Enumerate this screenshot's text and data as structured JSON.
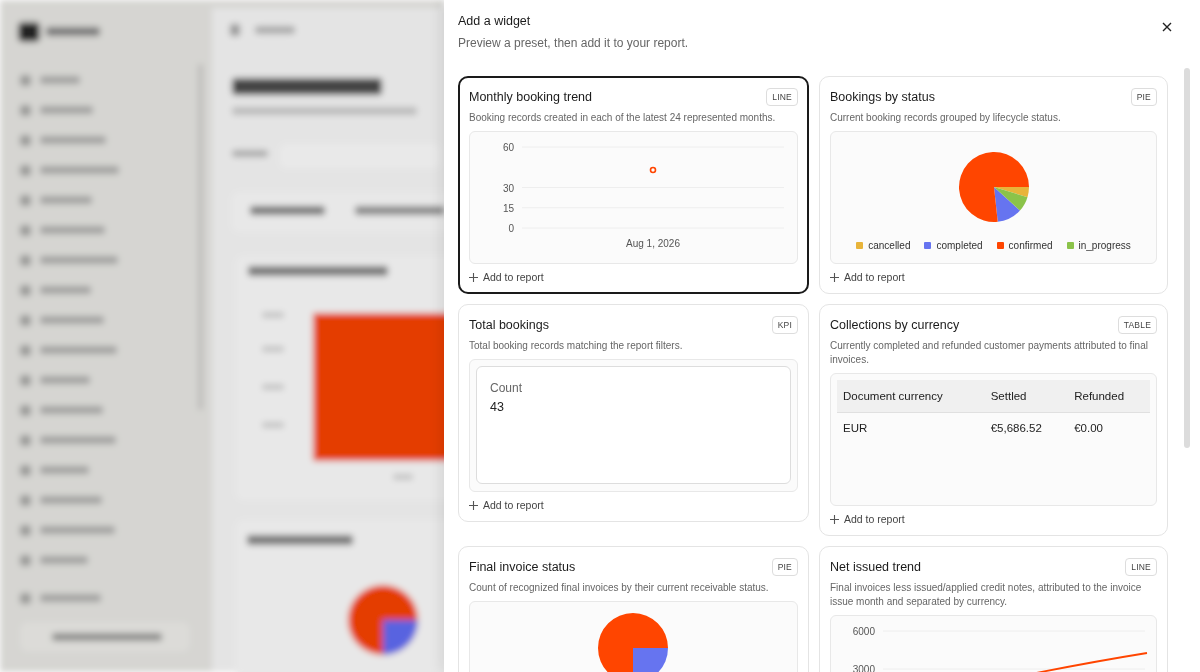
{
  "dialog": {
    "title": "Add a widget",
    "subtitle": "Preview a preset, then add it to your report."
  },
  "widgets": [
    {
      "kind": "chart",
      "title": "Monthly booking trend",
      "badge": "LINE",
      "selected": true,
      "description": "Booking records created in each of the latest 24 represented months.",
      "chart_data": {
        "type": "line",
        "categories": [
          "Aug 1, 2026"
        ],
        "series": [
          {
            "color": "#ff4500",
            "values": [
              43
            ],
            "marker": true
          }
        ],
        "ylim": [
          0,
          60
        ],
        "yticks": [
          0,
          15,
          30,
          60
        ]
      },
      "action": "Add to report"
    },
    {
      "kind": "chart",
      "title": "Bookings by status",
      "badge": "PIE",
      "selected": false,
      "description": "Current booking records grouped by lifecycle status.",
      "legend": [
        {
          "label": "cancelled",
          "color": "#e8b43a"
        },
        {
          "label": "completed",
          "color": "#6674f0"
        },
        {
          "label": "confirmed",
          "color": "#ff4500"
        },
        {
          "label": "in_progress",
          "color": "#8bc34a"
        }
      ],
      "chart_data": {
        "type": "pie",
        "values": [
          4.7,
          11.6,
          76.7,
          7.0
        ]
      },
      "action": "Add to report"
    },
    {
      "kind": "kpi",
      "title": "Total bookings",
      "badge": "KPI",
      "selected": false,
      "description": "Total booking records matching the report filters.",
      "kpi_label": "Count",
      "kpi_value": "43",
      "action": "Add to report"
    },
    {
      "kind": "table",
      "title": "Collections by currency",
      "badge": "TABLE",
      "selected": false,
      "description": "Currently completed and refunded customer payments attributed to final invoices.",
      "columns": [
        "Document currency",
        "Settled",
        "Refunded"
      ],
      "rows": [
        [
          "EUR",
          "€5,686.52",
          "€0.00"
        ]
      ],
      "action": "Add to report"
    },
    {
      "kind": "chart",
      "title": "Final invoice status",
      "badge": "PIE",
      "selected": false,
      "description": "Count of recognized final invoices by their current receivable status.",
      "chart_data": {
        "type": "pie",
        "values": [
          75,
          25
        ]
      }
    },
    {
      "kind": "trend",
      "title": "Net issued trend",
      "badge": "LINE",
      "selected": false,
      "description": "Final invoices less issued/applied credit notes, attributed to the invoice issue month and separated by currency.",
      "y_ticks": [
        "6000",
        "3000"
      ]
    }
  ]
}
